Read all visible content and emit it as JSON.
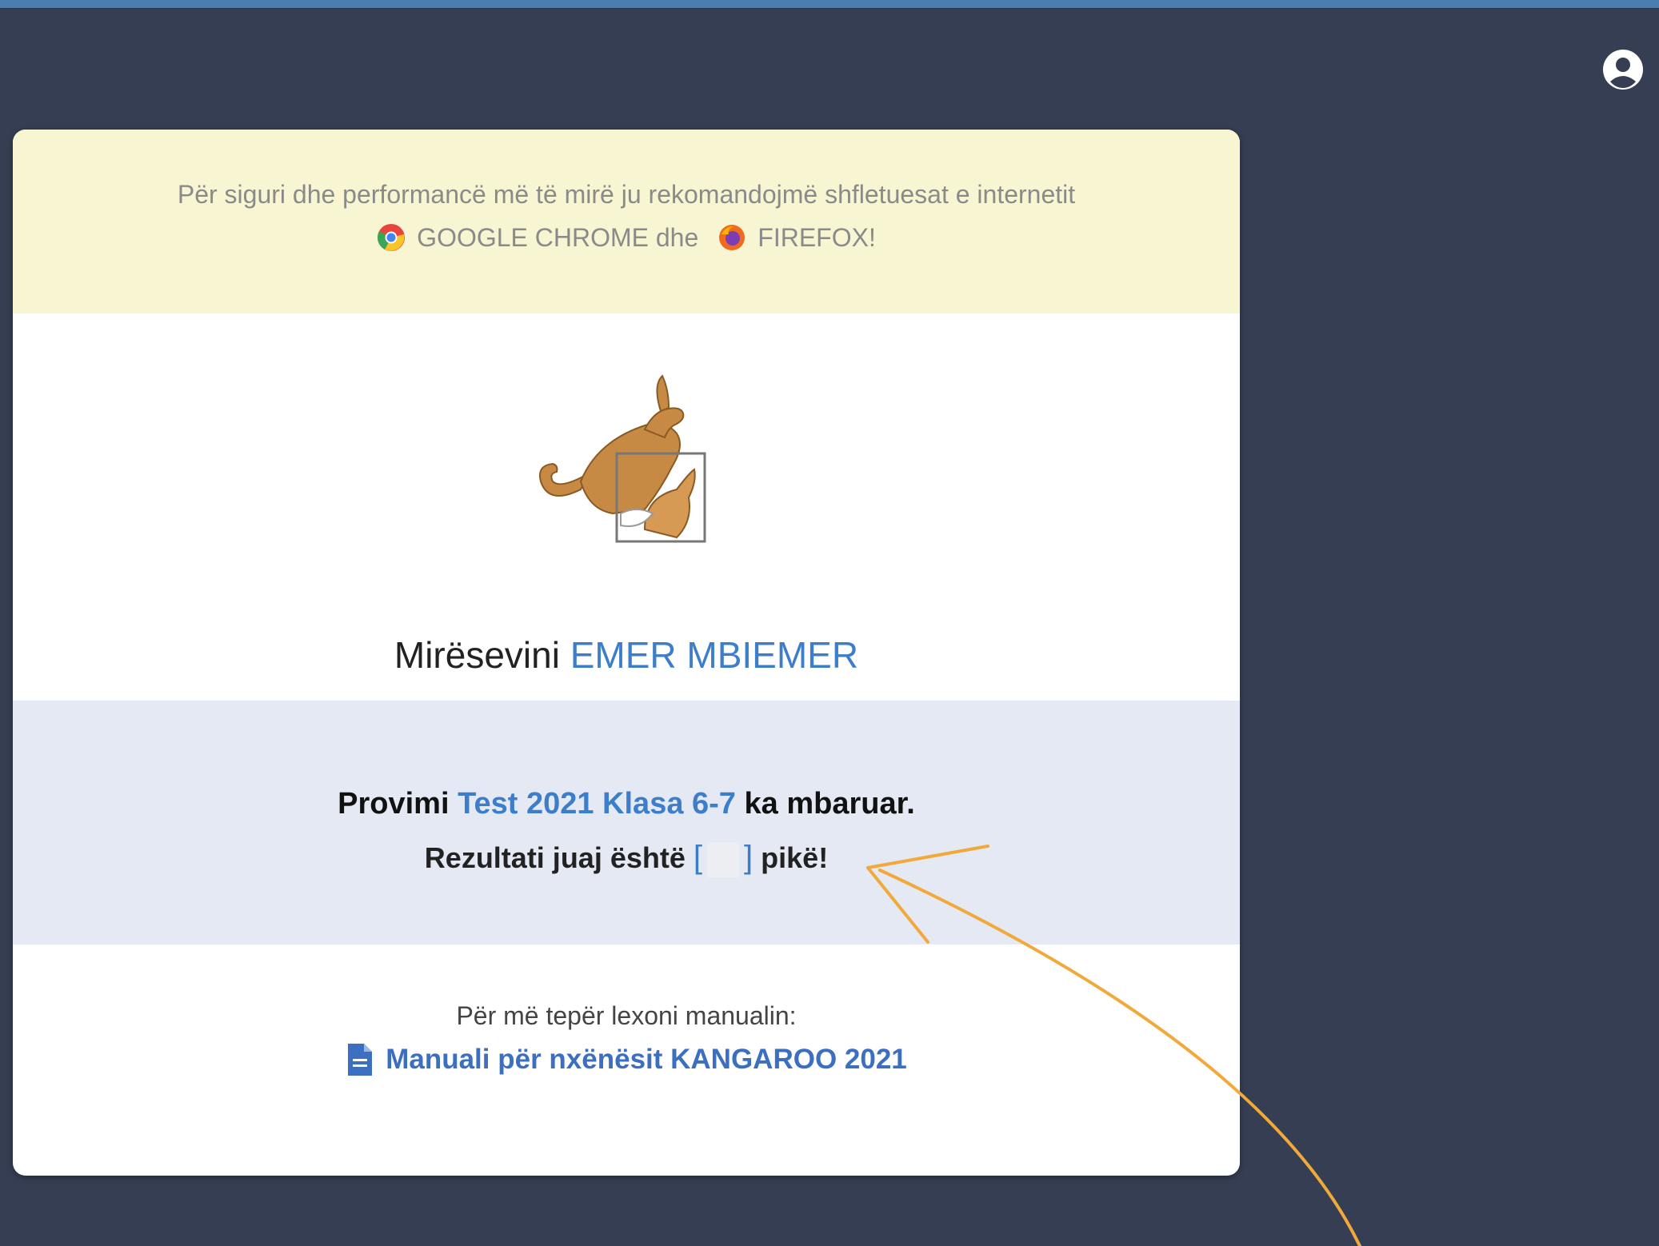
{
  "notice": {
    "line1": "Për siguri dhe performancë më të mirë ju rekomandojmë shfletuesat e internetit",
    "chrome": "GOOGLE CHROME dhe",
    "firefox": "FIREFOX!"
  },
  "welcome": {
    "greeting": "Mirësevini",
    "user_name": "EMER MBIEMER"
  },
  "exam": {
    "prefix": "Provimi",
    "name": "Test 2021 Klasa 6-7",
    "suffix": "ka mbaruar."
  },
  "score": {
    "prefix": "Rezultati juaj është",
    "open_bracket": "[",
    "close_bracket": "]",
    "suffix": "pikë!"
  },
  "manual": {
    "intro": "Për më tepër lexoni manualin:",
    "link": "Manuali për nxënësit KANGAROO 2021"
  },
  "colors": {
    "background": "#353e53",
    "accent": "#3d7ecb",
    "notice_bg": "#f8f6d2",
    "result_bg": "#e5e9f3",
    "annotation": "#f2a93b"
  },
  "icons": [
    "user-circle-icon",
    "chrome-icon",
    "firefox-icon",
    "kangaroo-logo",
    "document-icon"
  ]
}
